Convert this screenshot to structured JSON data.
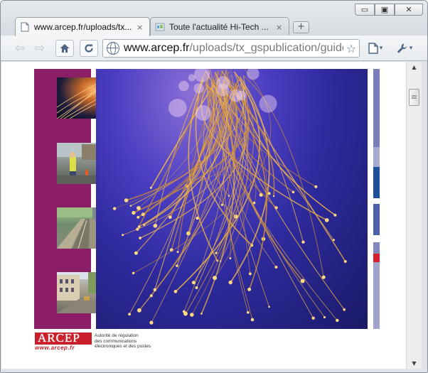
{
  "window": {
    "controls": {
      "minimize": "▭",
      "maximize": "▣",
      "close": "✕"
    }
  },
  "tabs": [
    {
      "title": "www.arcep.fr/uploads/tx...",
      "active": true,
      "icon": "page-icon"
    },
    {
      "title": "Toute l'actualité Hi-Tech ...",
      "active": false,
      "icon": "site-favicon"
    }
  ],
  "tab_close_glyph": "×",
  "new_tab_glyph": "+",
  "toolbar": {
    "back": "⇦",
    "forward": "⇨",
    "home": "⌂",
    "reload": "↻",
    "url_host": "www.arcep.fr",
    "url_path": "/uploads/tx_gspublication/guide-",
    "bookmark": "☆",
    "page_menu": "▤",
    "wrench_menu": "⚒",
    "menu_caret": "▾"
  },
  "scrollbar": {
    "up": "▲",
    "down": "▼"
  },
  "document": {
    "logo_text": "ARCEP",
    "logo_url": "www.arcep.fr",
    "caption": [
      "Autorité de régulation",
      "des communications",
      "électroniques et des postes"
    ],
    "colors": {
      "sidebar": "#8c1e68",
      "logo_red": "#c91f2b"
    },
    "stripe_colors": [
      "#7a7fb8",
      "#a6aad0",
      "#1d4f9a",
      "#ffffff",
      "#4b60a8",
      "#ffffff",
      "#8387bd",
      "#d71f2f",
      "#9fa2cc"
    ]
  }
}
